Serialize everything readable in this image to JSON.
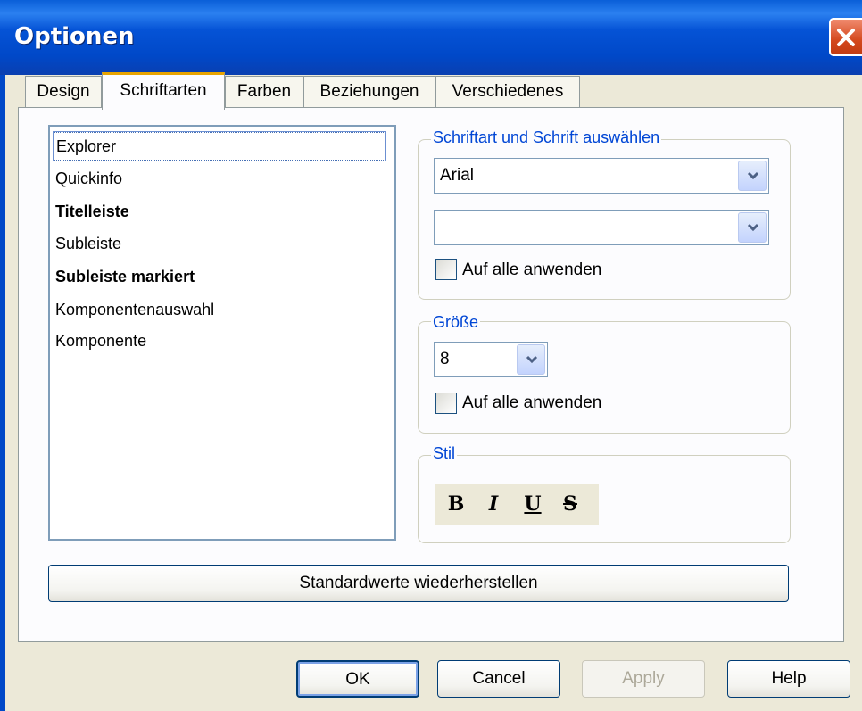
{
  "window": {
    "title": "Optionen"
  },
  "tabs": [
    {
      "label": "Design"
    },
    {
      "label": "Schriftarten"
    },
    {
      "label": "Farben"
    },
    {
      "label": "Beziehungen"
    },
    {
      "label": "Verschiedenes"
    }
  ],
  "active_tab": "Schriftarten",
  "font_list": {
    "items": [
      {
        "label": "Explorer",
        "selected": true
      },
      {
        "label": "Quickinfo"
      },
      {
        "label": "Titelleiste",
        "bold": true
      },
      {
        "label": "Subleiste"
      },
      {
        "label": "Subleiste markiert",
        "bold": true
      },
      {
        "label": "Komponentenauswahl"
      },
      {
        "label": "Komponente"
      }
    ]
  },
  "font_group": {
    "title": "Schriftart und Schrift auswählen",
    "font_select": {
      "value": "Arial"
    },
    "script_select": {
      "value": ""
    },
    "apply_all_label": "Auf alle anwenden"
  },
  "size_group": {
    "title": "Größe",
    "size_select": {
      "value": "8"
    },
    "apply_all_label": "Auf alle anwenden"
  },
  "style_group": {
    "title": "Stil",
    "buttons": {
      "bold": "B",
      "italic": "I",
      "underline": "U",
      "strikethrough": "S"
    }
  },
  "restore_defaults_label": "Standardwerte wiederherstellen",
  "footer": {
    "ok": "OK",
    "cancel": "Cancel",
    "apply": "Apply",
    "help": "Help"
  }
}
